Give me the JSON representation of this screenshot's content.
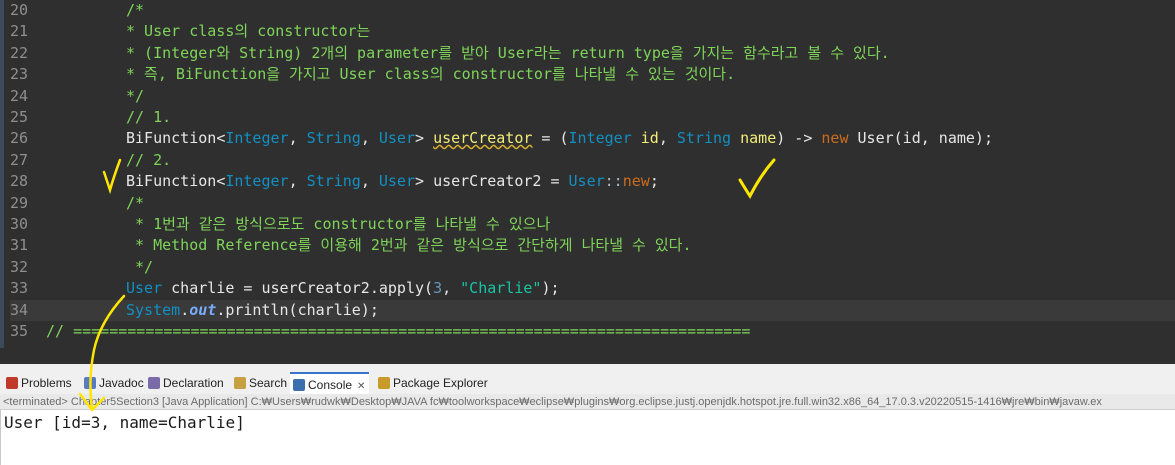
{
  "editor": {
    "lines": [
      {
        "n": "20",
        "text": "/*"
      },
      {
        "n": "21",
        "text": "* User class의 constructor는"
      },
      {
        "n": "22",
        "text": "* (Integer와 String) 2개의 parameter를 받아 User라는 return type을 가지는 함수라고 볼 수 있다."
      },
      {
        "n": "23",
        "text": "* 즉, BiFunction을 가지고 User class의 constructor를 나타낼 수 있는 것이다."
      },
      {
        "n": "24",
        "text": "*/"
      },
      {
        "n": "25",
        "text": "// 1."
      },
      {
        "n": "26",
        "text": ""
      },
      {
        "n": "27",
        "text": "// 2."
      },
      {
        "n": "28",
        "text": ""
      },
      {
        "n": "29",
        "text": "/*"
      },
      {
        "n": "30",
        "text": " * 1번과 같은 방식으로도 constructor를 나타낼 수 있으나"
      },
      {
        "n": "31",
        "text": " * Method Reference를 이용해 2번과 같은 방식으로 간단하게 나타낼 수 있다."
      },
      {
        "n": "32",
        "text": " */"
      },
      {
        "n": "33",
        "text": ""
      },
      {
        "n": "34",
        "text": ""
      },
      {
        "n": "35",
        "text": "// ==========================================================================="
      }
    ],
    "tokens": {
      "bifunction": "BiFunction",
      "lt": "<",
      "integer": "Integer",
      "comma": ", ",
      "string": "String",
      "user": "User",
      "gt": "> ",
      "userCreator": "userCreator",
      "assign": " = (",
      "id": " id",
      "name": " name",
      "arrow": ") -> ",
      "new": "new",
      "ctorcall": " User(id, name);",
      "userCreator2": "userCreator2",
      "eq": " = ",
      "mref": "User",
      "colons": "::",
      "newkw": "new",
      "semi": ";",
      "charlie_decl": " charlie = userCreator2.apply(",
      "three": "3",
      "comma2": ", ",
      "charlie_str": "\"Charlie\"",
      "close": ");",
      "system": "System",
      "dot": ".",
      "out": "out",
      "println": ".println(charlie);"
    },
    "hscroll_arrow": "<"
  },
  "panel": {
    "tabs": [
      {
        "label": "Problems",
        "icon": "problems-icon"
      },
      {
        "label": "Javadoc",
        "icon": "javadoc-icon"
      },
      {
        "label": "Declaration",
        "icon": "declaration-icon"
      },
      {
        "label": "Search",
        "icon": "search-icon"
      },
      {
        "label": "Console",
        "icon": "console-icon",
        "active": true
      },
      {
        "label": "Package Explorer",
        "icon": "package-explorer-icon"
      }
    ],
    "close_glyph": "✕",
    "terminated": "<terminated> Chapter5Section3 [Java Application] C:₩Users₩rudwk₩Desktop₩JAVA fc₩toolworkspace₩eclipse₩plugins₩org.eclipse.justj.openjdk.hotspot.jre.full.win32.x86_64_17.0.3.v20220515-1416₩jre₩bin₩javaw.ex",
    "console_output": "User [id=3, name=Charlie]"
  },
  "colors": {
    "editor_bg": "#2f2f2f",
    "comment": "#7fd45a",
    "keyword": "#cc6c1d",
    "type": "#1290c3",
    "handwriting": "#ffe600"
  }
}
